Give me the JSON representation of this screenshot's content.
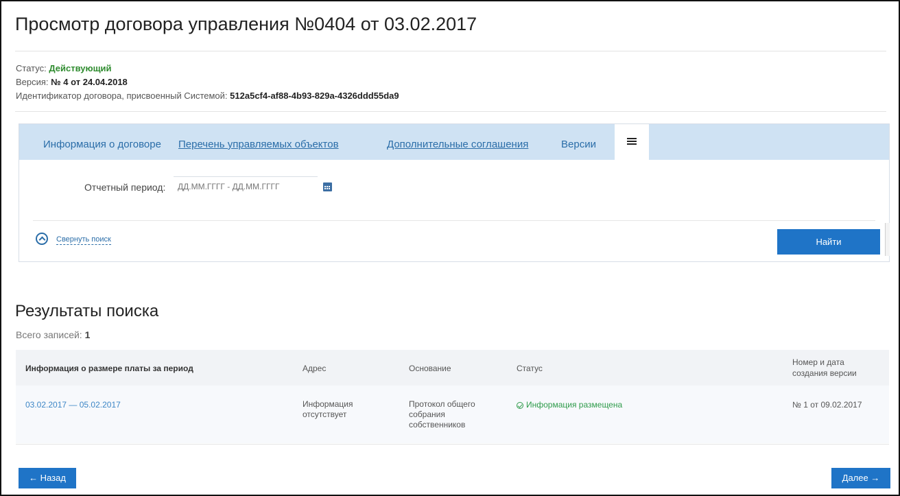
{
  "header": {
    "title": "Просмотр договора управления №0404 от 03.02.2017",
    "status_label": "Статус:",
    "status_value": "Действующий",
    "version_label": "Версия:",
    "version_value": "№ 4 от 24.04.2018",
    "id_label": "Идентификатор договора, присвоенный Системой:",
    "id_value": "512a5cf4-af88-4b93-829a-4326ddd55da9"
  },
  "tabs": [
    {
      "label": "Информация о договоре"
    },
    {
      "label": "Перечень управляемых объектов"
    },
    {
      "label": "Дополнительные соглашения"
    },
    {
      "label": "Версии"
    },
    {
      "label": "",
      "icon": "list-icon",
      "active": true
    }
  ],
  "search": {
    "period_label": "Отчетный период:",
    "period_placeholder": "ДД.ММ.ГГГГ - ДД.ММ.ГГГГ",
    "collapse_label": "Свернуть поиск",
    "find_label": "Найти"
  },
  "results": {
    "title": "Результаты поиска",
    "total_label": "Всего записей:",
    "total_value": "1",
    "columns": [
      "Информация о размере платы за период",
      "Адрес",
      "Основание",
      "Статус",
      "Номер и дата создания версии"
    ],
    "rows": [
      {
        "period": "03.02.2017 — 05.02.2017",
        "address": "Информация отсутствует",
        "basis": "Протокол общего собрания собственников",
        "status": "Информация размещена",
        "version": "№ 1 от 09.02.2017"
      }
    ]
  },
  "nav": {
    "back_label": "← Назад",
    "next_label": "Далее →"
  },
  "colors": {
    "accent": "#1f74c7",
    "tabbar": "#cfe2f3",
    "status_green": "#2e8b2e",
    "link": "#2a6da8"
  }
}
